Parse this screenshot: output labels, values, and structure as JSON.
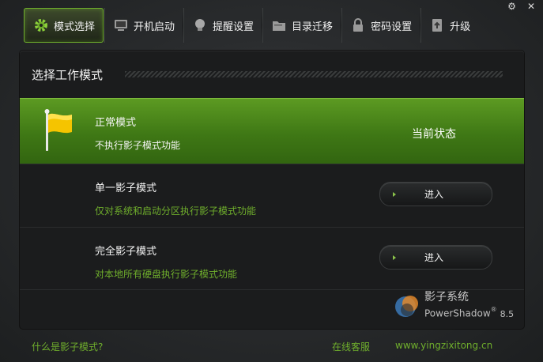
{
  "window_controls": {
    "settings_glyph": "⚙",
    "close_glyph": "✕"
  },
  "toolbar": {
    "tabs": [
      {
        "label": "模式选择",
        "icon": "gear-icon",
        "active": true
      },
      {
        "label": "开机启动",
        "icon": "monitor-icon"
      },
      {
        "label": "提醒设置",
        "icon": "lightbulb-icon"
      },
      {
        "label": "目录迁移",
        "icon": "folder-icon"
      },
      {
        "label": "密码设置",
        "icon": "lock-icon"
      },
      {
        "label": "升级",
        "icon": "upgrade-icon"
      }
    ]
  },
  "panel": {
    "title": "选择工作模式",
    "modes": [
      {
        "title": "正常模式",
        "desc": "不执行影子模式功能",
        "status": "当前状态",
        "icon": "yellow-flag-icon"
      },
      {
        "title": "单一影子模式",
        "desc": "仅对系统和启动分区执行影子模式功能",
        "button": "进入"
      },
      {
        "title": "完全影子模式",
        "desc": "对本地所有硬盘执行影子模式功能",
        "button": "进入"
      }
    ],
    "brand": {
      "cn": "影子系统",
      "en": "PowerShadow",
      "reg": "®",
      "version": "8.5"
    }
  },
  "footer": {
    "help_link": "什么是影子模式?",
    "support_link": "在线客服",
    "website_link": "www.yingzixitong.cn"
  },
  "colors": {
    "accent_green": "#6fae2c",
    "active_row": "#4a8a1a",
    "background": "#2a2c2e"
  }
}
